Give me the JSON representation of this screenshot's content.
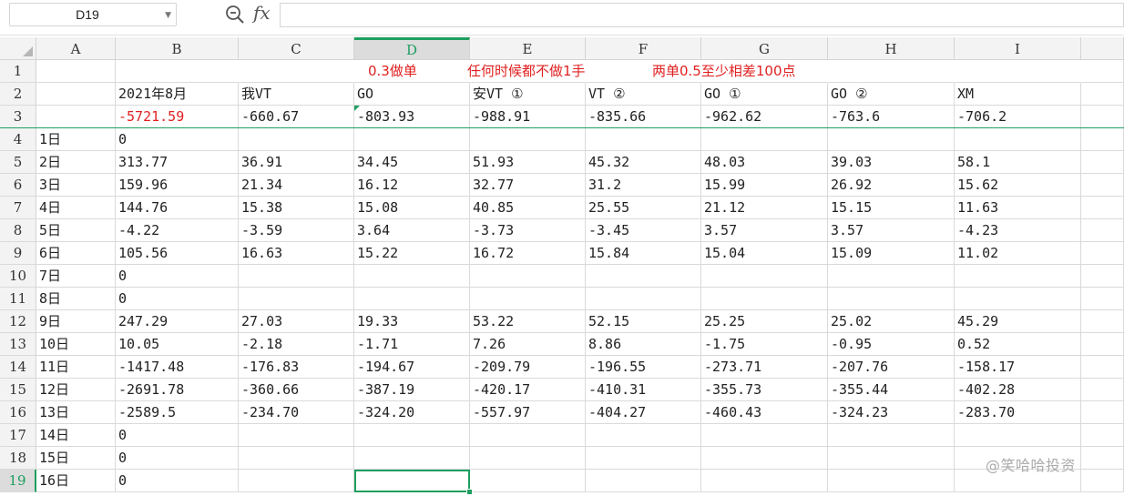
{
  "formula_bar": {
    "name_box": "D19",
    "fx_label": "fx",
    "formula": ""
  },
  "columns": [
    "A",
    "B",
    "C",
    "D",
    "E",
    "F",
    "G",
    "H",
    "I"
  ],
  "selected_col": "D",
  "selected_row": "19",
  "notes": [
    "0.3做单",
    "任何时候都不做1手",
    "两单0.5至少相差100点"
  ],
  "rows": [
    {
      "num": "1",
      "cells": [
        "",
        "",
        "",
        "",
        "",
        "",
        "",
        "",
        ""
      ]
    },
    {
      "num": "2",
      "cells": [
        "",
        "2021年8月",
        "我VT",
        "GO",
        "安VT ①",
        "VT ②",
        "GO ①",
        "GO ②",
        "XM"
      ]
    },
    {
      "num": "3",
      "cells": [
        "",
        "-5721.59",
        "-660.67",
        "-803.93",
        "-988.91",
        "-835.66",
        "-962.62",
        "-763.6",
        "-706.2"
      ]
    },
    {
      "num": "4",
      "cells": [
        "1日",
        "0",
        "",
        "",
        "",
        "",
        "",
        "",
        ""
      ]
    },
    {
      "num": "5",
      "cells": [
        "2日",
        "313.77",
        "36.91",
        "34.45",
        "51.93",
        "45.32",
        "48.03",
        "39.03",
        "58.1"
      ]
    },
    {
      "num": "6",
      "cells": [
        "3日",
        "159.96",
        "21.34",
        "16.12",
        "32.77",
        "31.2",
        "15.99",
        "26.92",
        "15.62"
      ]
    },
    {
      "num": "7",
      "cells": [
        "4日",
        "144.76",
        "15.38",
        "15.08",
        "40.85",
        "25.55",
        "21.12",
        "15.15",
        "11.63"
      ]
    },
    {
      "num": "8",
      "cells": [
        "5日",
        "-4.22",
        "-3.59",
        "3.64",
        "-3.73",
        "-3.45",
        "3.57",
        "3.57",
        "-4.23"
      ]
    },
    {
      "num": "9",
      "cells": [
        "6日",
        "105.56",
        "16.63",
        "15.22",
        "16.72",
        "15.84",
        "15.04",
        "15.09",
        "11.02"
      ]
    },
    {
      "num": "10",
      "cells": [
        "7日",
        "0",
        "",
        "",
        "",
        "",
        "",
        "",
        ""
      ]
    },
    {
      "num": "11",
      "cells": [
        "8日",
        "0",
        "",
        "",
        "",
        "",
        "",
        "",
        ""
      ]
    },
    {
      "num": "12",
      "cells": [
        "9日",
        "247.29",
        "27.03",
        "19.33",
        "53.22",
        "52.15",
        "25.25",
        "25.02",
        "45.29"
      ]
    },
    {
      "num": "13",
      "cells": [
        "10日",
        "10.05",
        "-2.18",
        "-1.71",
        "7.26",
        "8.86",
        "-1.75",
        "-0.95",
        "0.52"
      ]
    },
    {
      "num": "14",
      "cells": [
        "11日",
        "-1417.48",
        "-176.83",
        "-194.67",
        "-209.79",
        "-196.55",
        "-273.71",
        "-207.76",
        "-158.17"
      ]
    },
    {
      "num": "15",
      "cells": [
        "12日",
        "-2691.78",
        "-360.66",
        "-387.19",
        "-420.17",
        "-410.31",
        "-355.73",
        "-355.44",
        "-402.28"
      ]
    },
    {
      "num": "16",
      "cells": [
        "13日",
        "-2589.5",
        "-234.70",
        "-324.20",
        "-557.97",
        "-404.27",
        "-460.43",
        "-324.23",
        "-283.70"
      ]
    },
    {
      "num": "17",
      "cells": [
        "14日",
        "0",
        "",
        "",
        "",
        "",
        "",
        "",
        ""
      ]
    },
    {
      "num": "18",
      "cells": [
        "15日",
        "0",
        "",
        "",
        "",
        "",
        "",
        "",
        ""
      ]
    },
    {
      "num": "19",
      "cells": [
        "16日",
        "0",
        "",
        "",
        "",
        "",
        "",
        "",
        ""
      ]
    }
  ],
  "watermark": "@笑哈哈投资",
  "colors": {
    "accent": "#1e9e60",
    "negative_total": "#e02020",
    "header_bg": "#f3f3f3",
    "grid": "#dadada"
  }
}
